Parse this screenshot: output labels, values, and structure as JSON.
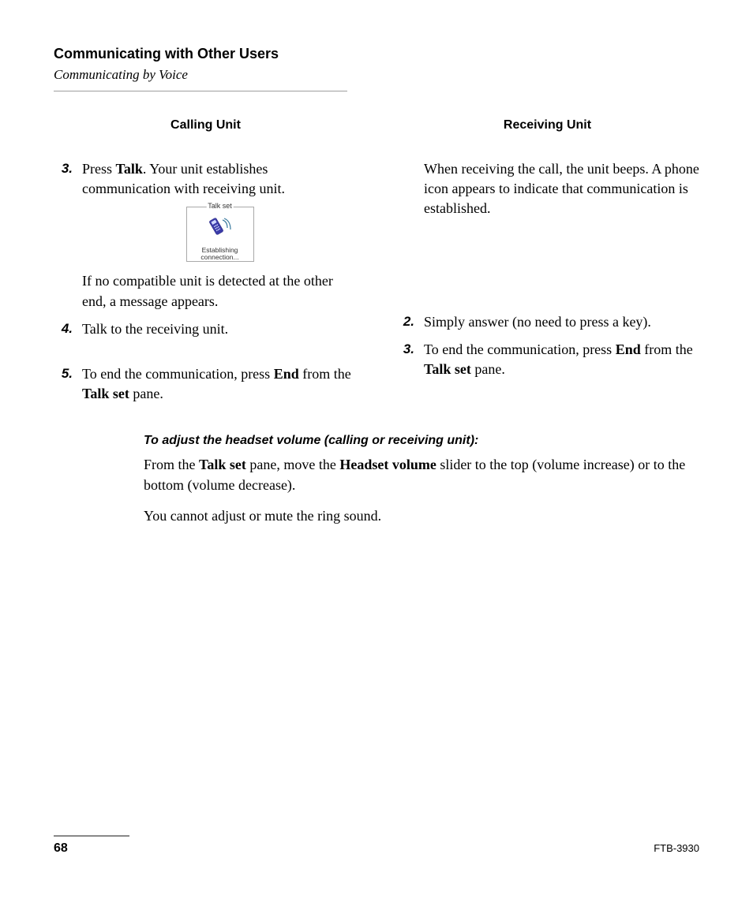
{
  "header": {
    "section_title": "Communicating with Other Users",
    "section_subtitle": "Communicating by Voice"
  },
  "columns": {
    "left_head": "Calling Unit",
    "right_head": "Receiving Unit"
  },
  "left": {
    "step3_num": "3.",
    "step3_pre": "Press ",
    "step3_b1": "Talk",
    "step3_post": ". Your unit establishes communication with receiving unit.",
    "box_legend": "Talk set",
    "box_caption_l1": "Establishing",
    "box_caption_l2": "connection...",
    "step3_tail": "If no compatible unit is detected at the other end, a message appears.",
    "step4_num": "4.",
    "step4_text": "Talk to the receiving unit.",
    "step5_num": "5.",
    "step5_pre": "To end the communication, press ",
    "step5_b1": "End",
    "step5_mid": " from the ",
    "step5_b2": "Talk set",
    "step5_post": " pane."
  },
  "right": {
    "step3_text": "When receiving the call, the unit beeps. A phone icon appears to indicate that communication is established.",
    "step2_num": "2.",
    "step2_text": "Simply answer (no need to press a key).",
    "step3b_num": "3.",
    "step3b_pre": "To end the communication, press ",
    "step3b_b1": "End",
    "step3b_mid": " from the ",
    "step3b_b2": "Talk set",
    "step3b_post": " pane."
  },
  "volume": {
    "heading": "To adjust the headset volume (calling or receiving unit):",
    "p1_pre": "From the ",
    "p1_b1": "Talk set",
    "p1_mid": " pane, move the ",
    "p1_b2": "Headset volume",
    "p1_post": " slider to the top (volume increase) or to the bottom (volume decrease).",
    "p2": "You cannot adjust or mute the ring sound."
  },
  "footer": {
    "page": "68",
    "doc": "FTB-3930"
  }
}
